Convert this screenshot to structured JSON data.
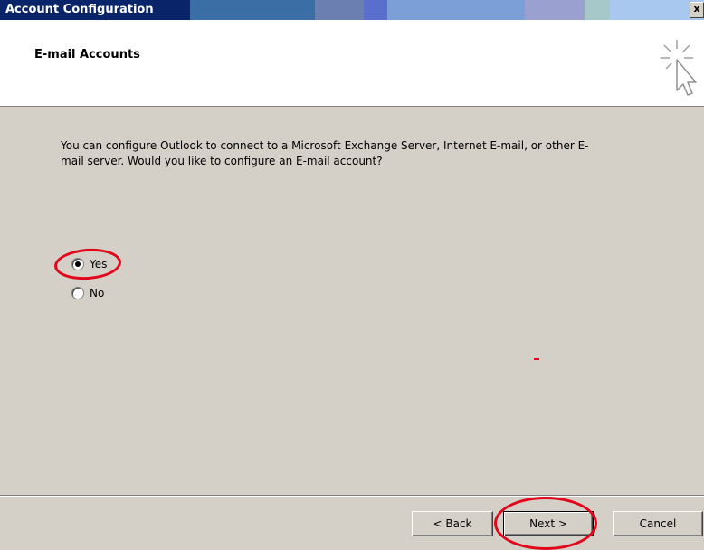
{
  "window": {
    "title": "Account Configuration",
    "close_glyph": "x",
    "title_bar_colors": [
      "#0a246a",
      "#3a6ea5",
      "#6b7fb0",
      "#5a6fcc",
      "#7d9fd8",
      "#a0b0dc",
      "#9aa0d0",
      "#a6c8c8",
      "#a8c8f0"
    ]
  },
  "header": {
    "title": "E-mail Accounts",
    "icon": "wizard-cursor-sparkle-icon"
  },
  "body": {
    "question": "You can configure Outlook to connect to a Microsoft Exchange Server, Internet E-mail, or other E-mail server.  Would you like to configure an E-mail account?",
    "options": [
      {
        "label": "Yes",
        "selected": true
      },
      {
        "label": "No",
        "selected": false
      }
    ]
  },
  "buttons": {
    "back": "< Back",
    "next": "Next >",
    "cancel": "Cancel"
  },
  "annotations": {
    "highlight_color": "#e3061b",
    "highlighted": [
      "Yes",
      "Next >"
    ]
  }
}
